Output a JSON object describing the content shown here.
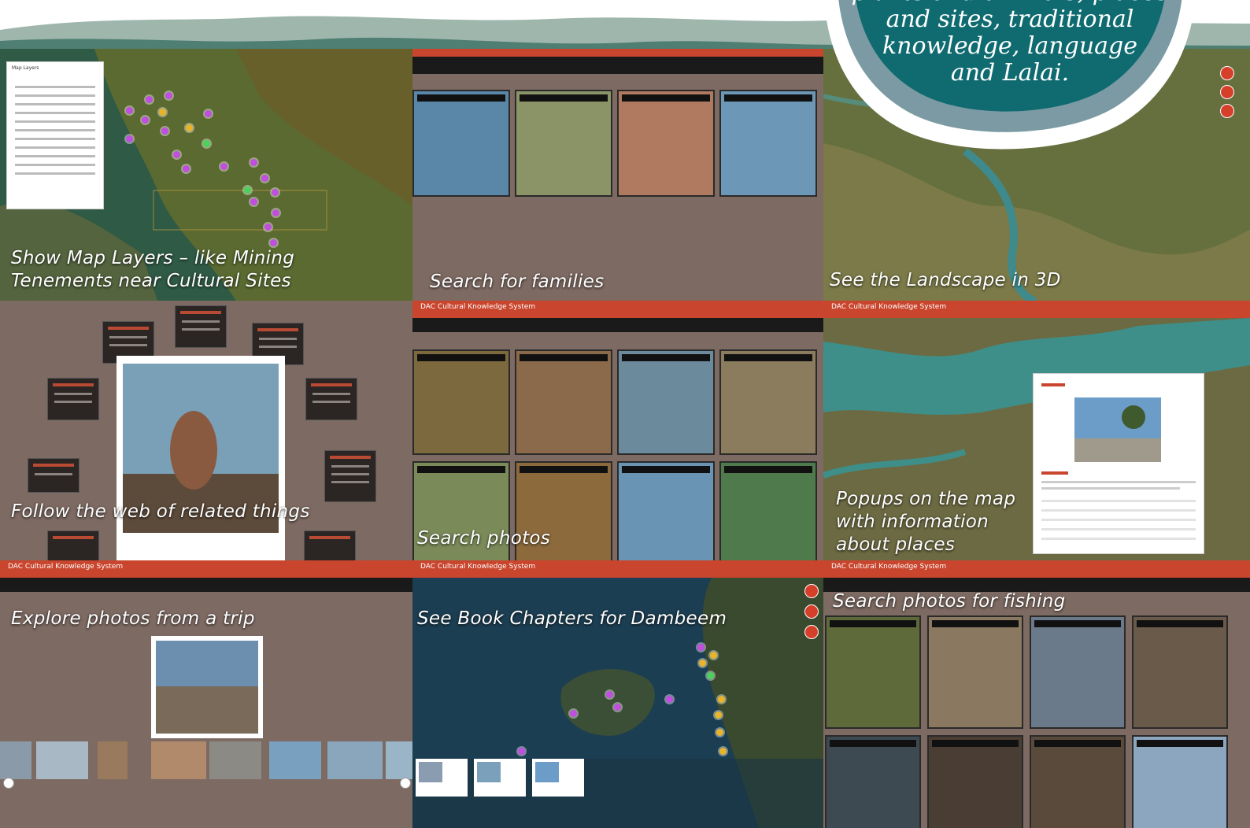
{
  "bubble": {
    "text": "plants and animals, places\nand sites, traditional\nknowledge, language\nand Lalai."
  },
  "tiles": {
    "map_layers": {
      "caption": "Show Map Layers – like Mining\nTenements near Cultural Sites",
      "panel_title": "Map Layers"
    },
    "families": {
      "caption": "Search for families"
    },
    "landscape": {
      "caption": "See the Landscape in 3D"
    },
    "web": {
      "caption": "Follow the web of related things"
    },
    "photos": {
      "caption": "Search photos",
      "app_title": "DAC Cultural Knowledge System"
    },
    "popups": {
      "caption": "Popups on the map\n with information\nabout places",
      "app_title": "DAC Cultural Knowledge System"
    },
    "trip": {
      "caption": "Explore photos from a trip",
      "app_title": "DAC Cultural Knowledge System"
    },
    "chapters": {
      "caption": "See Book Chapters for Dambeem",
      "app_title": "DAC Cultural Knowledge System"
    },
    "fishing": {
      "caption": "Search photos for fishing",
      "app_title": "DAC Cultural Knowledge System"
    }
  },
  "colors": {
    "header_red": "#c9452d",
    "bubble_teal": "#0f6b70",
    "bubble_ring": "#7c9aa3"
  }
}
